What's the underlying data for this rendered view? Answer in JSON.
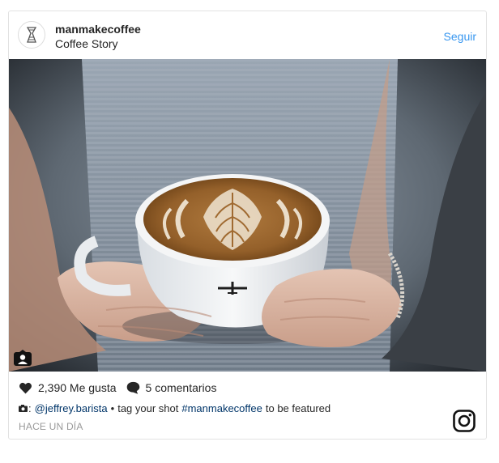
{
  "header": {
    "username": "manmakecoffee",
    "subtitle": "Coffee Story",
    "follow_label": "Seguir"
  },
  "photo": {
    "icon": "user-tag-icon"
  },
  "stats": {
    "likes_label": "2,390 Me gusta",
    "comments_label": "5 comentarios",
    "like_icon": "heart-icon",
    "comment_icon": "comment-bubble-icon"
  },
  "caption": {
    "camera_prefix": ":",
    "credit_user": "@jeffrey.barista",
    "separator": "•",
    "text_before": "tag your shot",
    "hashtag": "#manmakecoffee",
    "text_after": "to be featured"
  },
  "time": "HACE UN DÍA",
  "colors": {
    "accent": "#3897f0",
    "link": "#003569",
    "muted": "#999999",
    "text": "#262626"
  }
}
